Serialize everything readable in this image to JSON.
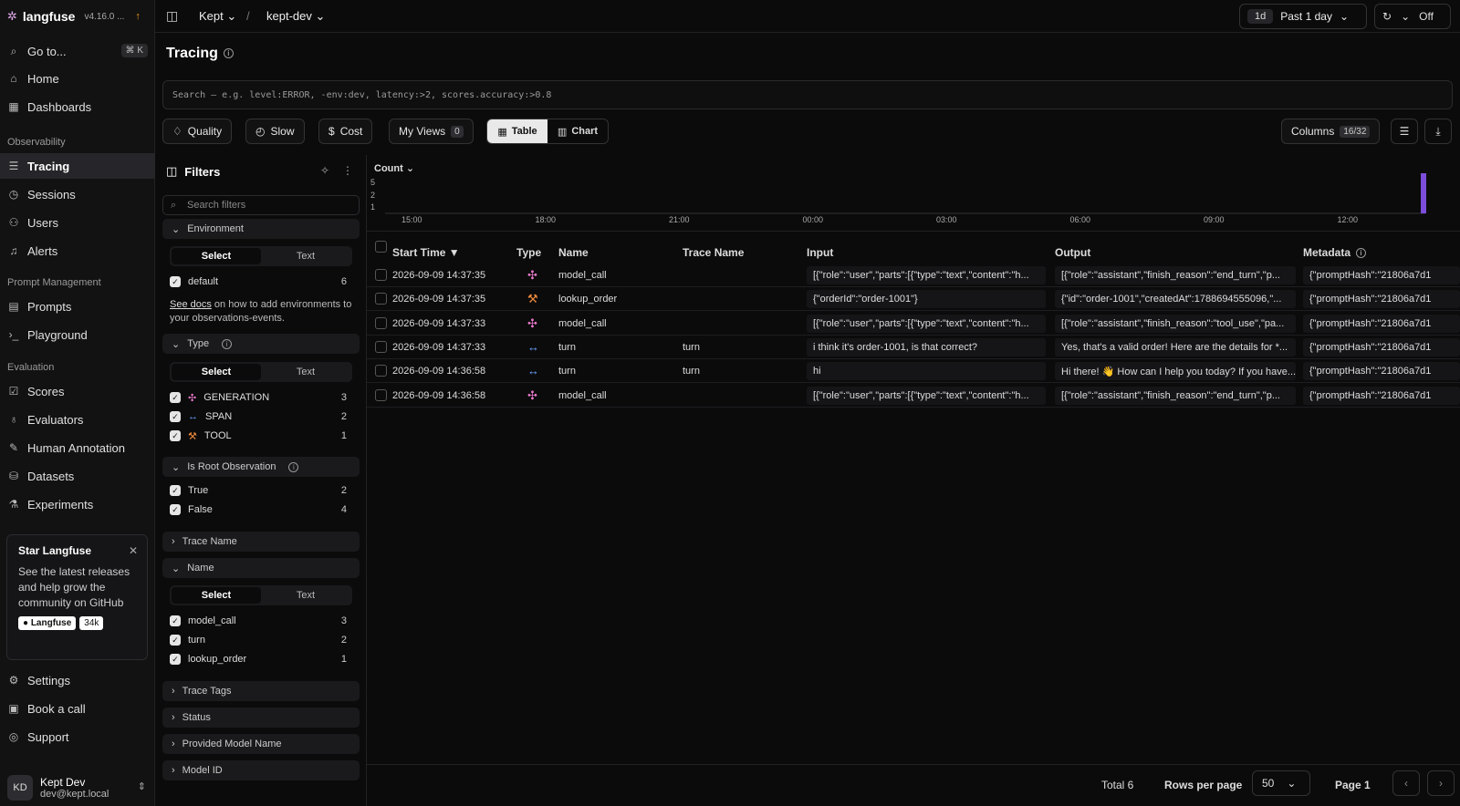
{
  "app": {
    "logo": "langfuse",
    "version": "v4.16.0 ...",
    "update_arrow": "↑"
  },
  "nav": {
    "goto": "Go to...",
    "goto_kbd": "⌘ K",
    "home": "Home",
    "dashboards": "Dashboards",
    "section_observability": "Observability",
    "tracing": "Tracing",
    "sessions": "Sessions",
    "users": "Users",
    "alerts": "Alerts",
    "section_prompt": "Prompt Management",
    "prompts": "Prompts",
    "playground": "Playground",
    "section_evaluation": "Evaluation",
    "scores": "Scores",
    "evaluators": "Evaluators",
    "human_annotation": "Human Annotation",
    "datasets": "Datasets",
    "experiments": "Experiments",
    "settings": "Settings",
    "book_call": "Book a call",
    "support": "Support"
  },
  "star_card": {
    "title": "Star Langfuse",
    "text": "See the latest releases and help grow the community on GitHub",
    "gh_label": "Langfuse",
    "gh_count": "34k"
  },
  "user": {
    "initials": "KD",
    "name": "Kept Dev",
    "email": "dev@kept.local"
  },
  "topbar": {
    "org": "Kept",
    "project": "kept-dev",
    "range_short": "1d",
    "range_label": "Past 1 day",
    "refresh_label": "Off"
  },
  "page": {
    "title": "Tracing"
  },
  "search": {
    "placeholder": "Search — e.g. level:ERROR, -env:dev, latency:>2, scores.accuracy:>0.8"
  },
  "toolbar": {
    "quality": "Quality",
    "slow": "Slow",
    "cost": "Cost",
    "my_views": "My Views",
    "my_views_count": "0",
    "table": "Table",
    "chart": "Chart",
    "columns": "Columns",
    "columns_count": "16/32"
  },
  "filters": {
    "title": "Filters",
    "search_placeholder": "Search filters",
    "select": "Select",
    "text": "Text",
    "environment": "Environment",
    "env_default": "default",
    "env_default_count": "6",
    "see_docs": "See docs",
    "docs_rest": " on how to add environments to your observations-events.",
    "type": "Type",
    "type_generation": "GENERATION",
    "type_generation_count": "3",
    "type_span": "SPAN",
    "type_span_count": "2",
    "type_tool": "TOOL",
    "type_tool_count": "1",
    "is_root": "Is Root Observation",
    "root_true": "True",
    "root_true_count": "2",
    "root_false": "False",
    "root_false_count": "4",
    "trace_name": "Trace Name",
    "name": "Name",
    "name_model_call": "model_call",
    "name_model_call_count": "3",
    "name_turn": "turn",
    "name_turn_count": "2",
    "name_lookup_order": "lookup_order",
    "name_lookup_order_count": "1",
    "trace_tags": "Trace Tags",
    "status": "Status",
    "provided_model": "Provided Model Name",
    "model_id": "Model ID"
  },
  "chart_data": {
    "type": "bar",
    "title": "",
    "ylabel": "Count",
    "yticks": [
      "5",
      "2",
      "1"
    ],
    "xticks": [
      "15:00",
      "18:00",
      "21:00",
      "00:00",
      "03:00",
      "06:00",
      "09:00",
      "12:00"
    ],
    "values": [
      6
    ],
    "bar_color": "#7c4ddb"
  },
  "table": {
    "headers": {
      "start_time": "Start Time ▼",
      "type": "Type",
      "name": "Name",
      "trace_name": "Trace Name",
      "input": "Input",
      "output": "Output",
      "metadata": "Metadata"
    },
    "rows": [
      {
        "start": "2026-09-09 14:37:35",
        "type": "generation-icon",
        "name": "model_call",
        "trace": "",
        "input": "[{\"role\":\"user\",\"parts\":[{\"type\":\"text\",\"content\":\"h...",
        "output": "[{\"role\":\"assistant\",\"finish_reason\":\"end_turn\",\"p...",
        "meta": "{\"promptHash\":\"21806a7d1"
      },
      {
        "start": "2026-09-09 14:37:35",
        "type": "tool-icon",
        "name": "lookup_order",
        "trace": "",
        "input": "{\"orderId\":\"order-1001\"}",
        "output": "{\"id\":\"order-1001\",\"createdAt\":1788694555096,\"...",
        "meta": "{\"promptHash\":\"21806a7d1"
      },
      {
        "start": "2026-09-09 14:37:33",
        "type": "generation-icon",
        "name": "model_call",
        "trace": "",
        "input": "[{\"role\":\"user\",\"parts\":[{\"type\":\"text\",\"content\":\"h...",
        "output": "[{\"role\":\"assistant\",\"finish_reason\":\"tool_use\",\"pa...",
        "meta": "{\"promptHash\":\"21806a7d1"
      },
      {
        "start": "2026-09-09 14:37:33",
        "type": "span-icon",
        "name": "turn",
        "trace": "turn",
        "input": "i think it's order-1001, is that correct?",
        "output": "Yes, that's a valid order! Here are the details for *...",
        "meta": "{\"promptHash\":\"21806a7d1"
      },
      {
        "start": "2026-09-09 14:36:58",
        "type": "span-icon",
        "name": "turn",
        "trace": "turn",
        "input": "hi",
        "output": "Hi there! 👋 How can I help you today? If you have...",
        "meta": "{\"promptHash\":\"21806a7d1"
      },
      {
        "start": "2026-09-09 14:36:58",
        "type": "generation-icon",
        "name": "model_call",
        "trace": "",
        "input": "[{\"role\":\"user\",\"parts\":[{\"type\":\"text\",\"content\":\"h...",
        "output": "[{\"role\":\"assistant\",\"finish_reason\":\"end_turn\",\"p...",
        "meta": "{\"promptHash\":\"21806a7d1"
      }
    ]
  },
  "footer": {
    "total": "Total 6",
    "rows_per_page": "Rows per page",
    "rows_value": "50",
    "page": "Page 1"
  },
  "colors": {
    "generation": "#e879c9",
    "span": "#6aa2ff",
    "tool": "#f08a3a"
  }
}
